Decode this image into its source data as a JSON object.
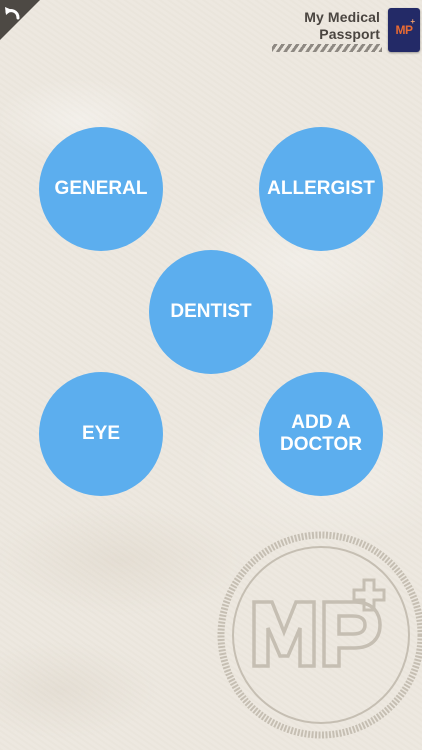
{
  "header": {
    "back_icon": "undo-arrow-icon",
    "brand_line1": "My Medical",
    "brand_line2": "Passport",
    "logo_text": "MP",
    "logo_plus": "+"
  },
  "categories": [
    {
      "label": "GENERAL"
    },
    {
      "label": "ALLERGIST"
    },
    {
      "label": "DENTIST"
    },
    {
      "label": "EYE"
    },
    {
      "label": "ADD A\nDOCTOR"
    }
  ],
  "colors": {
    "button": "#5caeee",
    "button_text": "#ffffff",
    "background": "#ede8df",
    "logo_bg": "#232a67",
    "logo_accent": "#e86a32"
  },
  "watermark": {
    "letters": "MP",
    "icon": "mp-stamp-watermark"
  }
}
